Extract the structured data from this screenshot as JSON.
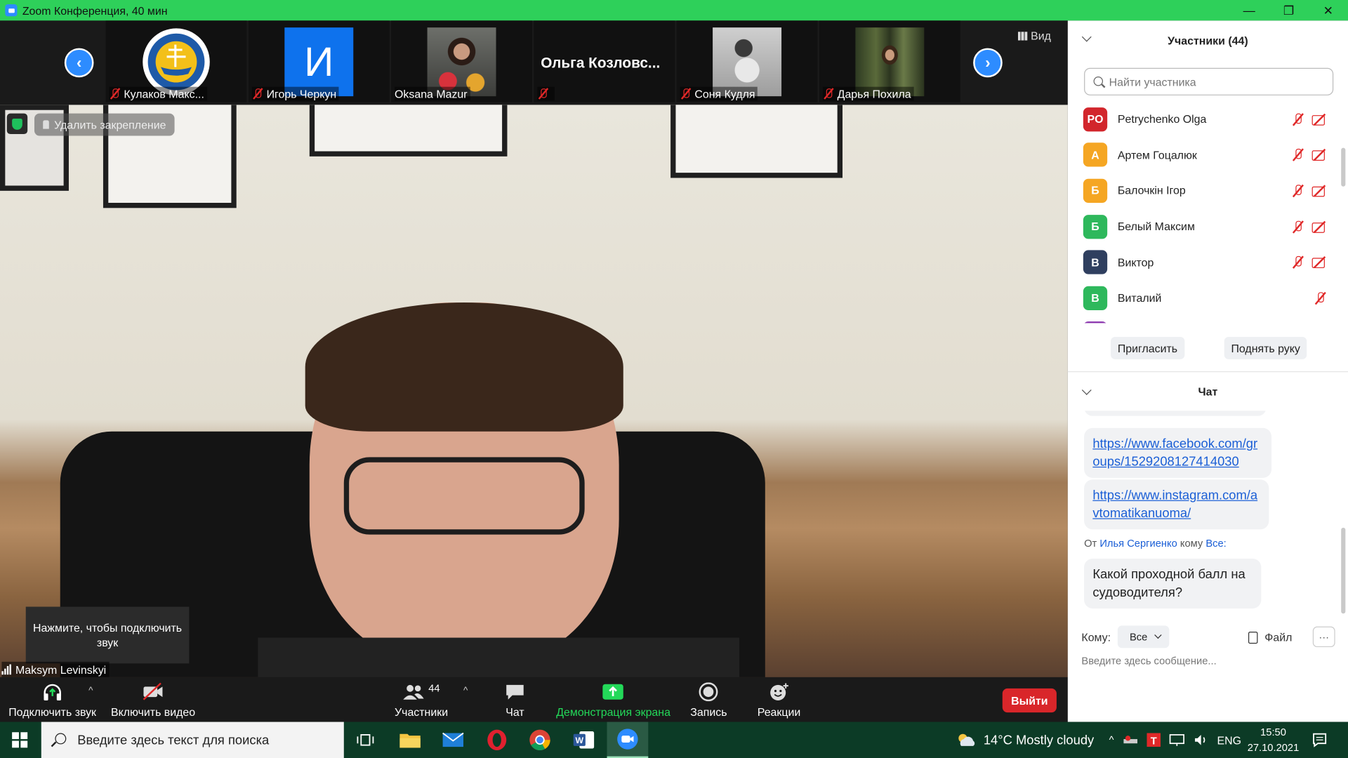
{
  "window": {
    "title": "Zoom Конференция, 40 мин",
    "controls": {
      "minimize": "—",
      "restore": "❐",
      "close": "✕"
    }
  },
  "strip": {
    "view_label": "Вид",
    "prev_glyph": "‹",
    "next_glyph": "›",
    "thumbnails": [
      {
        "name": "Кулаков Макс...",
        "muted": true,
        "kind": "logo"
      },
      {
        "name": "Игорь Черкун",
        "muted": true,
        "kind": "initial",
        "initial": "И",
        "color": "#0e72ed"
      },
      {
        "name": "Oksana Mazur",
        "muted": false,
        "kind": "photo"
      },
      {
        "name": "",
        "muted": true,
        "kind": "textname",
        "display": "Ольга  Козловс..."
      },
      {
        "name": "Соня Кудля",
        "muted": true,
        "kind": "photo-light"
      },
      {
        "name": "Дарья Похила",
        "muted": true,
        "kind": "photo-forest"
      }
    ]
  },
  "main": {
    "unpin_label": "Удалить закрепление",
    "tooltip": "Нажмите, чтобы подключить звук",
    "speaker_name": "Maksym Levinskyi"
  },
  "toolbar": {
    "audio": "Подключить звук",
    "video": "Включить видео",
    "participants": "Участники",
    "participants_count": "44",
    "chat": "Чат",
    "share": "Демонстрация экрана",
    "record": "Запись",
    "reactions": "Реакции",
    "leave": "Выйти",
    "share_color": "#23d959"
  },
  "participants": {
    "header": "Участники (44)",
    "search_placeholder": "Найти участника",
    "list": [
      {
        "initials": "PO",
        "name": "Petrychenko Olga",
        "color": "#d2262c",
        "mic_muted": true,
        "cam_off": true
      },
      {
        "initials": "А",
        "name": "Артем Гоцалюк",
        "color": "#f5a623",
        "mic_muted": true,
        "cam_off": true
      },
      {
        "initials": "Б",
        "name": "Балочкін Ігор",
        "color": "#f5a623",
        "mic_muted": true,
        "cam_off": true
      },
      {
        "initials": "Б",
        "name": "Белый Максим",
        "color": "#2eb85c",
        "mic_muted": true,
        "cam_off": true
      },
      {
        "initials": "В",
        "name": "Виктор",
        "color": "#2f3f5f",
        "mic_muted": true,
        "cam_off": true
      },
      {
        "initials": "В",
        "name": "Виталий",
        "color": "#2eb85c",
        "mic_muted": true,
        "cam_off": false
      }
    ],
    "invite": "Пригласить",
    "raise_hand": "Поднять руку"
  },
  "chat": {
    "header": "Чат",
    "messages": [
      {
        "text": "https://www.facebook.com/groups/1529208127414030",
        "link": true
      },
      {
        "text": "https://www.instagram.com/avtomatikanuoma/",
        "link": true
      }
    ],
    "from_prefix": "От",
    "from_name": "Илья Сергиенко",
    "from_mid": "кому",
    "from_to": "Все:",
    "last_message": "Какой проходной балл на судоводителя?",
    "to_label": "Кому:",
    "to_value": "Все",
    "file_label": "Файл",
    "more_label": "···",
    "input_placeholder": "Введите здесь сообщение..."
  },
  "taskbar": {
    "search_placeholder": "Введите здесь текст для поиска",
    "weather": "14°C  Mostly cloudy",
    "lang": "ENG",
    "time": "15:50",
    "date": "27.10.2021"
  }
}
